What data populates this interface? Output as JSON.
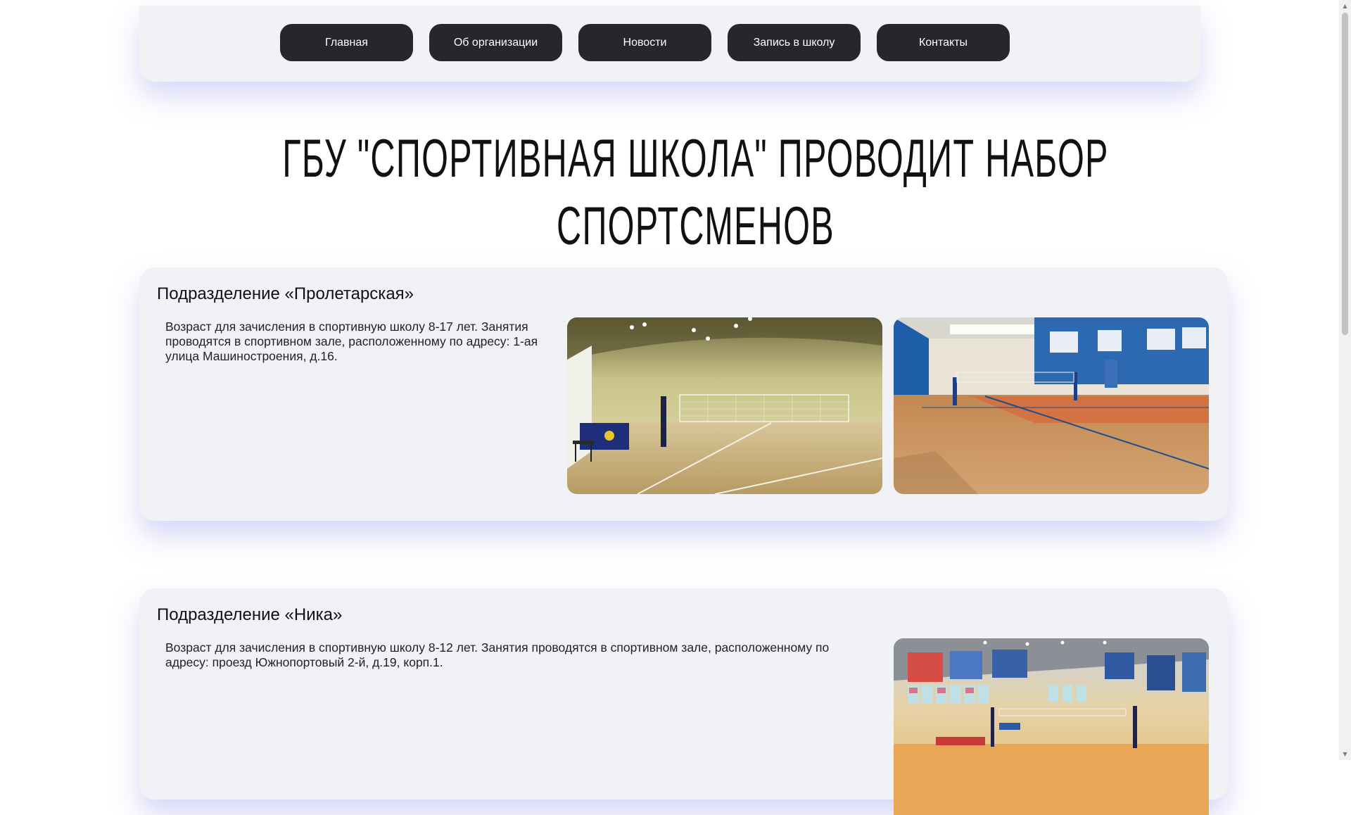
{
  "nav": {
    "items": [
      {
        "label": "Главная"
      },
      {
        "label": "Об организации"
      },
      {
        "label": "Новости"
      },
      {
        "label": "Запись в школу"
      },
      {
        "label": "Контакты"
      }
    ]
  },
  "page_title": "ГБУ \"СПОРТИВНАЯ ШКОЛА\" ПРОВОДИТ НАБОР СПОРТСМЕНОВ",
  "sections": [
    {
      "title": "Подразделение «Пролетарская»",
      "text_lines": [
        "Возраст для зачисления в спортивную школу 8-17 лет. Занятия",
        "проводятся в спортивном зале, расположенному по адресу: 1-ая",
        "улица Машиностроения, д.16."
      ]
    },
    {
      "title": "Подразделение «Ника»",
      "text_lines": [
        "Возраст для зачисления в спортивную школу 8-12 лет. Занятия проводятся в спортивном зале, расположенному по",
        "адресу: проезд Южнопортовый 2-й, д.19, корп.1."
      ]
    }
  ],
  "colors": {
    "nav_button_bg": "#25272b",
    "panel_bg": "#f1f2f5",
    "shadow": "#9696eb"
  },
  "scrollbar": {
    "up_icon": "▲",
    "down_icon": "▼"
  }
}
